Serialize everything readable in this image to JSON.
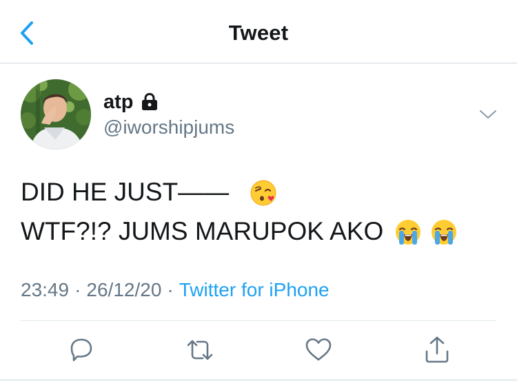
{
  "header": {
    "title": "Tweet",
    "back_icon": "chevron-left-icon",
    "accent": "#1da1f2"
  },
  "author": {
    "display_name": "atp",
    "handle": "@iworshipjums",
    "protected_icon": "lock-icon"
  },
  "tweet": {
    "line1": "DID HE JUST——",
    "line1_emojis": [
      "face-blowing-a-kiss"
    ],
    "line2": "WTF?!? JUMS MARUPOK AKO",
    "line2_emojis": [
      "loudly-crying-face",
      "loudly-crying-face"
    ]
  },
  "meta": {
    "time": "23:49",
    "separator": "·",
    "date": "26/12/20",
    "source": "Twitter for iPhone"
  },
  "actions": {
    "icons": [
      "reply-icon",
      "retweet-icon",
      "like-icon",
      "share-icon"
    ]
  },
  "colors": {
    "text": "#14171a",
    "secondary": "#657786",
    "link": "#1da1f2",
    "divider": "#e1e8ed"
  }
}
